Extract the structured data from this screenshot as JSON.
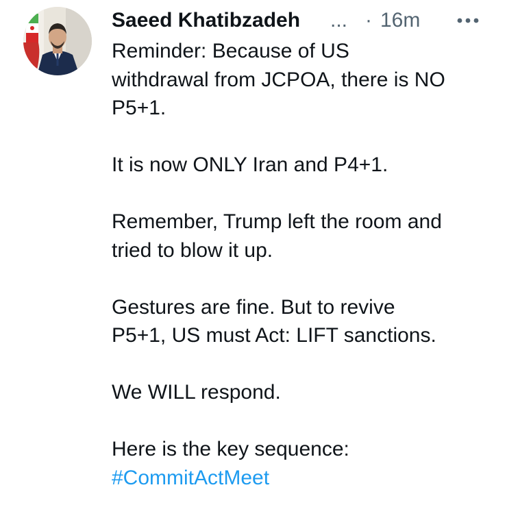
{
  "tweet": {
    "author": {
      "display_name": "Saeed Khatibzadeh",
      "truncation": "...",
      "avatar_icon": "profile-photo"
    },
    "separator": "·",
    "timestamp": "16m",
    "more_icon": "more-horizontal-icon",
    "paragraphs": [
      "Reminder: Because of US\nwithdrawal from JCPOA, there is NO\nP5+1.",
      "It is now ONLY Iran and P4+1.",
      "Remember, Trump left the room and\ntried to blow it up.",
      "Gestures are fine. But to revive\nP5+1, US must Act: LIFT sanctions.",
      "We WILL respond.",
      "Here is the key sequence:"
    ],
    "hashtag": "#CommitActMeet",
    "colors": {
      "text": "#0f1419",
      "secondary": "#536471",
      "link": "#1d9bf0",
      "background": "#ffffff"
    }
  }
}
